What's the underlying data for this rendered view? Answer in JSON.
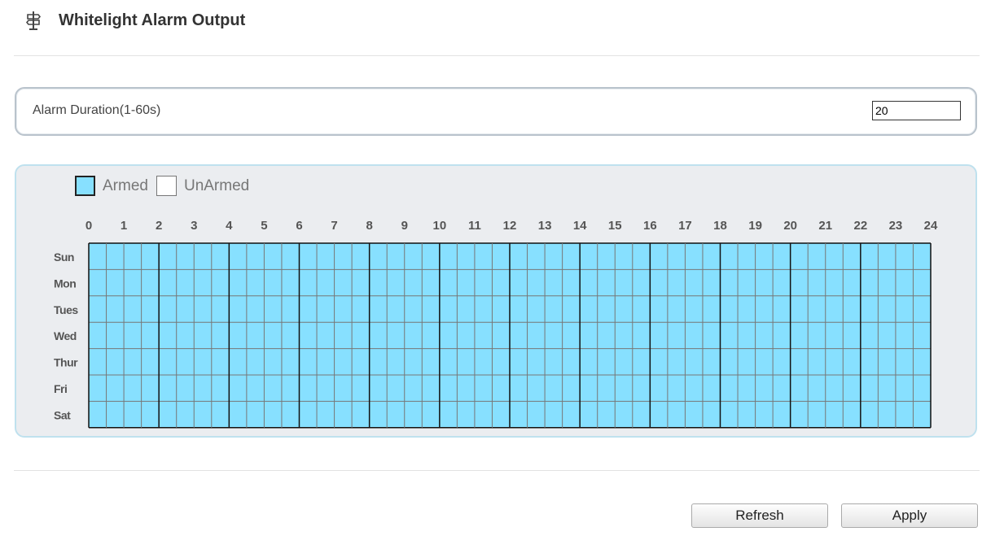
{
  "header": {
    "title": "Whitelight Alarm Output",
    "icon": "signpost-icon"
  },
  "duration": {
    "label": "Alarm Duration(1-60s)",
    "value": "20"
  },
  "legend": {
    "armed_label": "Armed",
    "unarmed_label": "UnArmed"
  },
  "schedule": {
    "hours": [
      "0",
      "1",
      "2",
      "3",
      "4",
      "5",
      "6",
      "7",
      "8",
      "9",
      "10",
      "11",
      "12",
      "13",
      "14",
      "15",
      "16",
      "17",
      "18",
      "19",
      "20",
      "21",
      "22",
      "23",
      "24"
    ],
    "days": [
      "Sun",
      "Mon",
      "Tues",
      "Wed",
      "Thur",
      "Fri",
      "Sat"
    ],
    "slots_per_day": 48,
    "state": "all-armed"
  },
  "colors": {
    "armed": "#87e0ff",
    "unarmed": "#ffffff",
    "panel_border": "#bfe1ee",
    "panel_bg": "#ebedf0"
  },
  "buttons": {
    "refresh": "Refresh",
    "apply": "Apply"
  }
}
